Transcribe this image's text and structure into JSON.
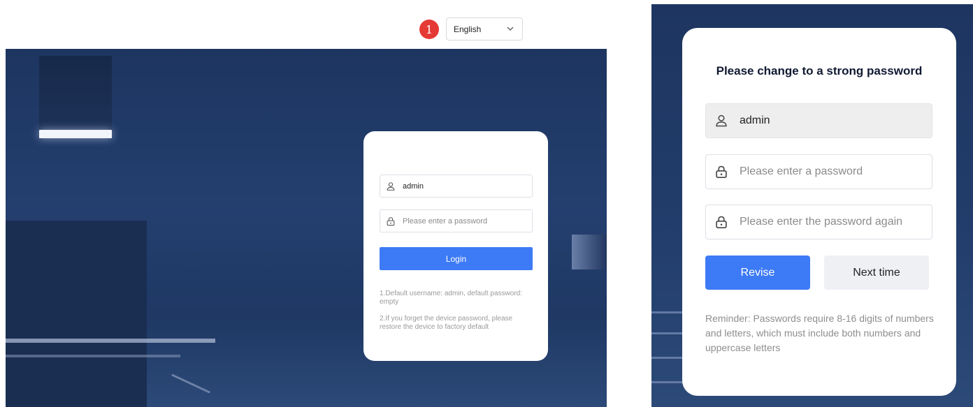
{
  "left": {
    "badge_number": "1",
    "language": {
      "selected": "English"
    },
    "login": {
      "username_value": "admin",
      "password_placeholder": "Please enter a password",
      "login_label": "Login",
      "note_1": "1.Default username: admin, default password: empty",
      "note_2": "2.If you forget the device password, please restore the device to factory default"
    }
  },
  "right": {
    "title": "Please change to a strong password",
    "username_value": "admin",
    "password_placeholder": "Please enter a password",
    "confirm_placeholder": "Please enter the password again",
    "revise_label": "Revise",
    "next_time_label": "Next time",
    "reminder": "Reminder: Passwords require 8-16 digits of numbers and letters, which must include both numbers and uppercase letters"
  },
  "icons": {
    "user": "user-icon",
    "lock": "lock-icon",
    "chevron": "chevron-down-icon"
  },
  "colors": {
    "primary": "#3d7af5",
    "badge": "#e53935",
    "background": "#1f3864"
  }
}
